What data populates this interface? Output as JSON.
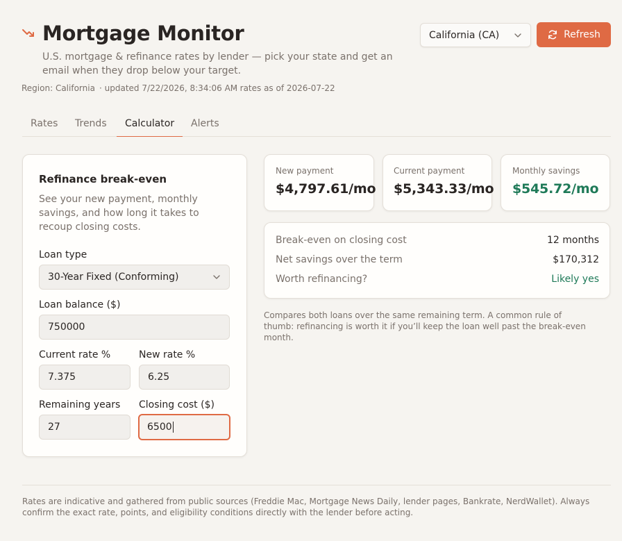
{
  "header": {
    "title": "Mortgage Monitor",
    "subtitle": "U.S. mortgage & refinance rates by lender — pick your state and get an email when they drop below your target.",
    "region": "Region: California",
    "updated": "· updated 7/22/2026, 8:34:06 AM",
    "rates_as_of": "· rates as of 2026-07-22",
    "state_select": "California (CA)",
    "refresh_label": "Refresh",
    "accent_color": "#df6a44"
  },
  "tabs": [
    {
      "label": "Rates",
      "active": false
    },
    {
      "label": "Trends",
      "active": false
    },
    {
      "label": "Calculator",
      "active": true
    },
    {
      "label": "Alerts",
      "active": false
    }
  ],
  "calculator": {
    "title": "Refinance break-even",
    "description": "See your new payment, monthly savings, and how long it takes to recoup closing costs.",
    "loan_type_label": "Loan type",
    "loan_type_value": "30-Year Fixed (Conforming)",
    "loan_balance_label": "Loan balance ($)",
    "loan_balance_value": "750000",
    "current_rate_label": "Current rate %",
    "current_rate_value": "7.375",
    "new_rate_label": "New rate %",
    "new_rate_value": "6.25",
    "remaining_years_label": "Remaining years",
    "remaining_years_value": "27",
    "closing_cost_label": "Closing cost ($)",
    "closing_cost_value": "6500"
  },
  "results": {
    "new_payment_label": "New payment",
    "new_payment_value": "$4,797.61/mo",
    "current_payment_label": "Current payment",
    "current_payment_value": "$5,343.33/mo",
    "monthly_savings_label": "Monthly savings",
    "monthly_savings_value": "$545.72/mo",
    "break_even_label": "Break-even on closing cost",
    "break_even_value": "12 months",
    "net_savings_label": "Net savings over the term",
    "net_savings_value": "$170,312",
    "worth_label": "Worth refinancing?",
    "worth_value": "Likely yes",
    "positive_color": "#1f7a58",
    "note": "Compares both loans over the same remaining term. A common rule of thumb: refinancing is worth it if you’ll keep the loan well past the break-even month."
  },
  "footer": {
    "disclaimer": "Rates are indicative and gathered from public sources (Freddie Mac, Mortgage News Daily, lender pages, Bankrate, NerdWallet). Always confirm the exact rate, points, and eligibility conditions directly with the lender before acting."
  }
}
